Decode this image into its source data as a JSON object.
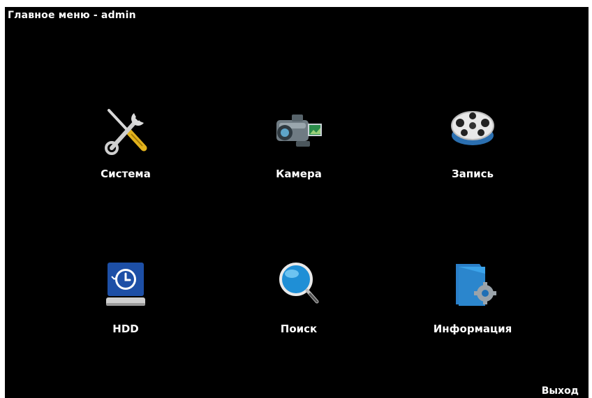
{
  "window": {
    "title": "Главное меню - admin"
  },
  "menu": {
    "items": [
      {
        "label": "Система",
        "icon": "tools-icon"
      },
      {
        "label": "Камера",
        "icon": "camcorder-icon"
      },
      {
        "label": "Запись",
        "icon": "film-reel-icon"
      },
      {
        "label": "HDD",
        "icon": "hdd-history-icon"
      },
      {
        "label": "Поиск",
        "icon": "magnifier-icon"
      },
      {
        "label": "Информация",
        "icon": "info-folder-gear-icon"
      }
    ]
  },
  "footer": {
    "exit_label": "Выход"
  },
  "colors": {
    "background": "#000000",
    "text": "#ffffff",
    "accent_blue": "#1f8fd6"
  }
}
